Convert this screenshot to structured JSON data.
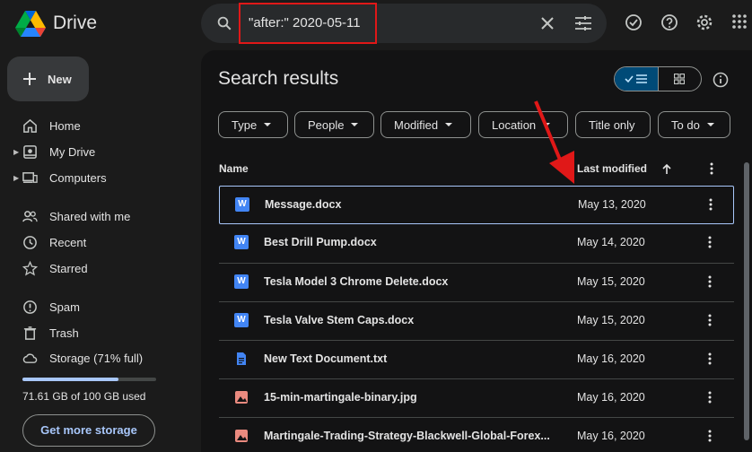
{
  "app": {
    "name": "Drive"
  },
  "search": {
    "query": "\"after:\" 2020-05-11"
  },
  "sidebar": {
    "new_label": "New",
    "items": [
      {
        "label": "Home",
        "icon": "home-icon"
      },
      {
        "label": "My Drive",
        "icon": "my-drive-icon"
      },
      {
        "label": "Computers",
        "icon": "computers-icon"
      },
      {
        "label": "Shared with me",
        "icon": "shared-icon"
      },
      {
        "label": "Recent",
        "icon": "clock-icon"
      },
      {
        "label": "Starred",
        "icon": "star-icon"
      },
      {
        "label": "Spam",
        "icon": "spam-icon"
      },
      {
        "label": "Trash",
        "icon": "trash-icon"
      },
      {
        "label": "Storage (71% full)",
        "icon": "cloud-icon"
      }
    ],
    "storage_fraction": 0.7161,
    "storage_used": "71.61 GB of 100 GB used",
    "get_more_storage": "Get more storage"
  },
  "main": {
    "title": "Search results",
    "filters": [
      "Type",
      "People",
      "Modified",
      "Location",
      "Title only",
      "To do"
    ],
    "columns": {
      "name": "Name",
      "modified": "Last modified"
    },
    "files": [
      {
        "name": "Message.docx",
        "date": "May 13, 2020",
        "kind": "word"
      },
      {
        "name": "Best Drill Pump.docx",
        "date": "May 14, 2020",
        "kind": "word"
      },
      {
        "name": "Tesla Model 3 Chrome Delete.docx",
        "date": "May 15, 2020",
        "kind": "word"
      },
      {
        "name": "Tesla Valve Stem Caps.docx",
        "date": "May 15, 2020",
        "kind": "word"
      },
      {
        "name": "New Text Document.txt",
        "date": "May 16, 2020",
        "kind": "text"
      },
      {
        "name": "15-min-martingale-binary.jpg",
        "date": "May 16, 2020",
        "kind": "image"
      },
      {
        "name": "Martingale-Trading-Strategy-Blackwell-Global-Forex...",
        "date": "May 16, 2020",
        "kind": "image"
      }
    ]
  },
  "colors": {
    "accent": "#a8c7fa",
    "highlight": "#e01818",
    "background": "#1b1b1b"
  }
}
